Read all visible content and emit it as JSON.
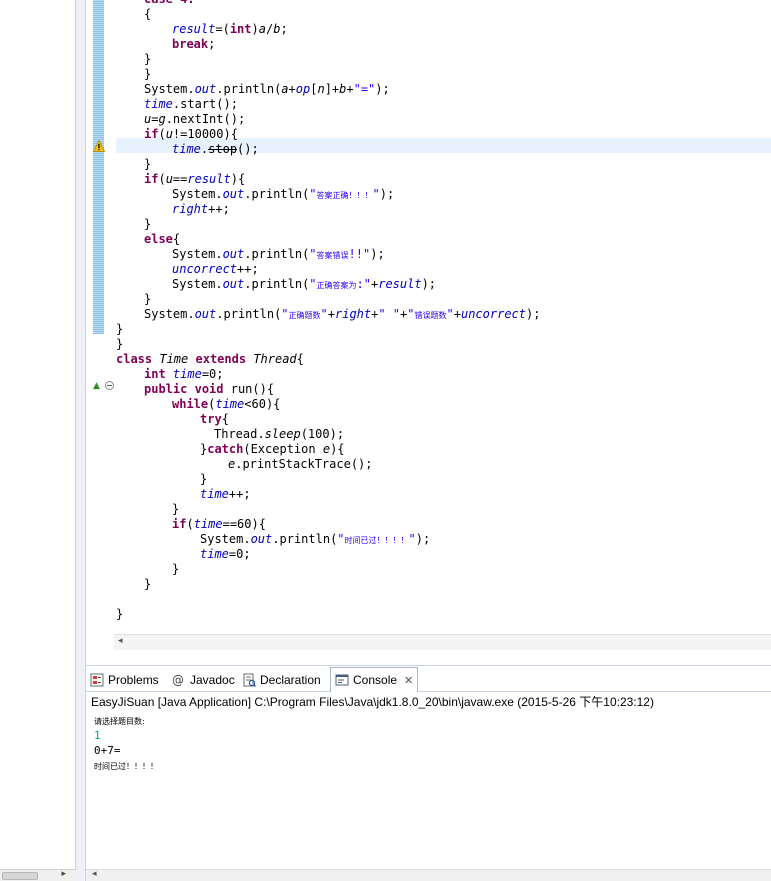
{
  "editor": {
    "lines": [
      {
        "segments": [
          {
            "t": "case 4:",
            "c": "kw"
          }
        ]
      },
      {
        "segments": [
          {
            "t": "{",
            "c": ""
          }
        ]
      },
      {
        "segments": [
          {
            "t": "result",
            "c": "fld"
          },
          {
            "t": "=(",
            "c": ""
          },
          {
            "t": "int",
            "c": "kw"
          },
          {
            "t": ")",
            "c": ""
          },
          {
            "t": "a",
            "c": "it"
          },
          {
            "t": "/",
            "c": ""
          },
          {
            "t": "b",
            "c": "it"
          },
          {
            "t": ";",
            "c": ""
          }
        ]
      },
      {
        "segments": [
          {
            "t": "break",
            "c": "kw"
          },
          {
            "t": ";",
            "c": ""
          }
        ]
      },
      {
        "segments": [
          {
            "t": "}",
            "c": ""
          }
        ]
      },
      {
        "segments": [
          {
            "t": "}",
            "c": ""
          }
        ]
      },
      {
        "segments": [
          {
            "t": "System.",
            "c": ""
          },
          {
            "t": "out",
            "c": "fld"
          },
          {
            "t": ".println(",
            "c": ""
          },
          {
            "t": "a",
            "c": "it"
          },
          {
            "t": "+",
            "c": ""
          },
          {
            "t": "op",
            "c": "fld"
          },
          {
            "t": "[",
            "c": ""
          },
          {
            "t": "n",
            "c": "it"
          },
          {
            "t": "]+",
            "c": ""
          },
          {
            "t": "b",
            "c": "it"
          },
          {
            "t": "+",
            "c": ""
          },
          {
            "t": "\"=\"",
            "c": "str"
          },
          {
            "t": ");",
            "c": ""
          }
        ]
      },
      {
        "segments": [
          {
            "t": "time",
            "c": "fld"
          },
          {
            "t": ".start();",
            "c": ""
          }
        ]
      },
      {
        "segments": [
          {
            "t": "u",
            "c": "it"
          },
          {
            "t": "=",
            "c": ""
          },
          {
            "t": "g",
            "c": "it"
          },
          {
            "t": ".nextInt();",
            "c": ""
          }
        ]
      },
      {
        "segments": [
          {
            "t": "if",
            "c": "kw"
          },
          {
            "t": "(",
            "c": ""
          },
          {
            "t": "u",
            "c": "it"
          },
          {
            "t": "!=10000){",
            "c": ""
          }
        ]
      },
      {
        "segments": [
          {
            "t": "time",
            "c": "fld"
          },
          {
            "t": ".",
            "c": ""
          },
          {
            "t": "stop",
            "c": "strike"
          },
          {
            "t": "();",
            "c": ""
          }
        ]
      },
      {
        "segments": [
          {
            "t": "}",
            "c": ""
          }
        ]
      },
      {
        "segments": [
          {
            "t": "if",
            "c": "kw"
          },
          {
            "t": "(",
            "c": ""
          },
          {
            "t": "u",
            "c": "it"
          },
          {
            "t": "==",
            "c": ""
          },
          {
            "t": "result",
            "c": "fld"
          },
          {
            "t": "){",
            "c": ""
          }
        ]
      },
      {
        "segments": [
          {
            "t": "System.",
            "c": ""
          },
          {
            "t": "out",
            "c": "fld"
          },
          {
            "t": ".println(",
            "c": ""
          },
          {
            "t": "\"",
            "c": "str"
          },
          {
            "t": "答案正确！！！",
            "c": "cjk"
          },
          {
            "t": "\"",
            "c": "str"
          },
          {
            "t": ");",
            "c": ""
          }
        ]
      },
      {
        "segments": [
          {
            "t": "right",
            "c": "fld"
          },
          {
            "t": "++;",
            "c": ""
          }
        ]
      },
      {
        "segments": [
          {
            "t": "}",
            "c": ""
          }
        ]
      },
      {
        "segments": [
          {
            "t": "else",
            "c": "kw"
          },
          {
            "t": "{",
            "c": ""
          }
        ]
      },
      {
        "segments": [
          {
            "t": "System.",
            "c": ""
          },
          {
            "t": "out",
            "c": "fld"
          },
          {
            "t": ".println(",
            "c": ""
          },
          {
            "t": "\"",
            "c": "str"
          },
          {
            "t": "答案错误",
            "c": "cjk"
          },
          {
            "t": "!!\"",
            "c": "str"
          },
          {
            "t": ");",
            "c": ""
          }
        ]
      },
      {
        "segments": [
          {
            "t": "uncorrect",
            "c": "fld"
          },
          {
            "t": "++;",
            "c": ""
          }
        ]
      },
      {
        "segments": [
          {
            "t": "System.",
            "c": ""
          },
          {
            "t": "out",
            "c": "fld"
          },
          {
            "t": ".println(",
            "c": ""
          },
          {
            "t": "\"",
            "c": "str"
          },
          {
            "t": "正确答案为",
            "c": "cjk"
          },
          {
            "t": ":\"",
            "c": "str"
          },
          {
            "t": "+",
            "c": ""
          },
          {
            "t": "result",
            "c": "fld"
          },
          {
            "t": ");",
            "c": ""
          }
        ]
      },
      {
        "segments": [
          {
            "t": "}",
            "c": ""
          }
        ]
      },
      {
        "segments": [
          {
            "t": "System.",
            "c": ""
          },
          {
            "t": "out",
            "c": "fld"
          },
          {
            "t": ".println(",
            "c": ""
          },
          {
            "t": "\"",
            "c": "str"
          },
          {
            "t": "正确题数",
            "c": "cjk"
          },
          {
            "t": "\"",
            "c": "str"
          },
          {
            "t": "+",
            "c": ""
          },
          {
            "t": "right",
            "c": "fld"
          },
          {
            "t": "+",
            "c": ""
          },
          {
            "t": "\" \"",
            "c": "str"
          },
          {
            "t": "+",
            "c": ""
          },
          {
            "t": "\"",
            "c": "str"
          },
          {
            "t": "错误题数",
            "c": "cjk"
          },
          {
            "t": "\"",
            "c": "str"
          },
          {
            "t": "+",
            "c": ""
          },
          {
            "t": "uncorrect",
            "c": "fld"
          },
          {
            "t": ");",
            "c": ""
          }
        ]
      },
      {
        "segments": [
          {
            "t": "}",
            "c": ""
          }
        ]
      },
      {
        "segments": [
          {
            "t": "}",
            "c": ""
          }
        ]
      },
      {
        "segments": [
          {
            "t": "class",
            "c": "kw"
          },
          {
            "t": " ",
            "c": ""
          },
          {
            "t": "Time",
            "c": "it"
          },
          {
            "t": " ",
            "c": ""
          },
          {
            "t": "extends",
            "c": "kw"
          },
          {
            "t": " ",
            "c": ""
          },
          {
            "t": "Thread",
            "c": "it"
          },
          {
            "t": "{",
            "c": ""
          }
        ]
      },
      {
        "segments": [
          {
            "t": "int",
            "c": "kw"
          },
          {
            "t": " ",
            "c": ""
          },
          {
            "t": "time",
            "c": "fld"
          },
          {
            "t": "=0;",
            "c": ""
          }
        ]
      },
      {
        "segments": [
          {
            "t": "public",
            "c": "kw"
          },
          {
            "t": " ",
            "c": ""
          },
          {
            "t": "void",
            "c": "kw"
          },
          {
            "t": " run(){",
            "c": ""
          }
        ]
      },
      {
        "segments": [
          {
            "t": "while",
            "c": "kw"
          },
          {
            "t": "(",
            "c": ""
          },
          {
            "t": "time",
            "c": "fld"
          },
          {
            "t": "<60){",
            "c": ""
          }
        ]
      },
      {
        "segments": [
          {
            "t": "try",
            "c": "kw"
          },
          {
            "t": "{",
            "c": ""
          }
        ]
      },
      {
        "segments": [
          {
            "t": "Thread.",
            "c": ""
          },
          {
            "t": "sleep",
            "c": "it"
          },
          {
            "t": "(100);",
            "c": ""
          }
        ]
      },
      {
        "segments": [
          {
            "t": "}",
            "c": ""
          },
          {
            "t": "catch",
            "c": "kw"
          },
          {
            "t": "(Exception ",
            "c": ""
          },
          {
            "t": "e",
            "c": "it"
          },
          {
            "t": "){",
            "c": ""
          }
        ]
      },
      {
        "segments": [
          {
            "t": "e",
            "c": "it"
          },
          {
            "t": ".printStackTrace();",
            "c": ""
          }
        ]
      },
      {
        "segments": [
          {
            "t": "}",
            "c": ""
          }
        ]
      },
      {
        "segments": [
          {
            "t": "time",
            "c": "fld"
          },
          {
            "t": "++;",
            "c": ""
          }
        ]
      },
      {
        "segments": [
          {
            "t": "}",
            "c": ""
          }
        ]
      },
      {
        "segments": [
          {
            "t": "if",
            "c": "kw"
          },
          {
            "t": "(",
            "c": ""
          },
          {
            "t": "time",
            "c": "fld"
          },
          {
            "t": "==60){",
            "c": ""
          }
        ]
      },
      {
        "segments": [
          {
            "t": "System.",
            "c": ""
          },
          {
            "t": "out",
            "c": "fld"
          },
          {
            "t": ".println(",
            "c": ""
          },
          {
            "t": "\"",
            "c": "str"
          },
          {
            "t": "时间已过！！！！",
            "c": "cjk"
          },
          {
            "t": "\"",
            "c": "str"
          },
          {
            "t": ");",
            "c": ""
          }
        ]
      },
      {
        "segments": [
          {
            "t": "time",
            "c": "fld"
          },
          {
            "t": "=0;",
            "c": ""
          }
        ]
      },
      {
        "segments": [
          {
            "t": "}",
            "c": ""
          }
        ]
      },
      {
        "segments": [
          {
            "t": "}",
            "c": ""
          }
        ]
      },
      {
        "segments": []
      },
      {
        "segments": [
          {
            "t": "}",
            "c": ""
          }
        ]
      }
    ]
  },
  "bottom_tabs": [
    {
      "label": "Problems",
      "icon": "problems-icon"
    },
    {
      "label": "Javadoc",
      "icon": "at-icon"
    },
    {
      "label": "Declaration",
      "icon": "declaration-icon"
    },
    {
      "label": "Console",
      "icon": "console-icon",
      "active": true
    }
  ],
  "console": {
    "header": "EasyJiSuan [Java Application] C:\\Program Files\\Java\\jdk1.8.0_20\\bin\\javaw.exe (2015-5-26 下午10:23:12)",
    "lines": [
      {
        "text": "请选择题目数:",
        "kind": "small"
      },
      {
        "text": "1",
        "kind": "input"
      },
      {
        "text": "0+7=",
        "kind": "normal"
      },
      {
        "text": "时间已过！！！！",
        "kind": "small"
      }
    ]
  },
  "colors": {
    "keyword": "#7f0055",
    "field": "#0000c0",
    "string": "#2a00ff",
    "console_input": "#00a87e",
    "current_line": "#e8f2fe"
  }
}
